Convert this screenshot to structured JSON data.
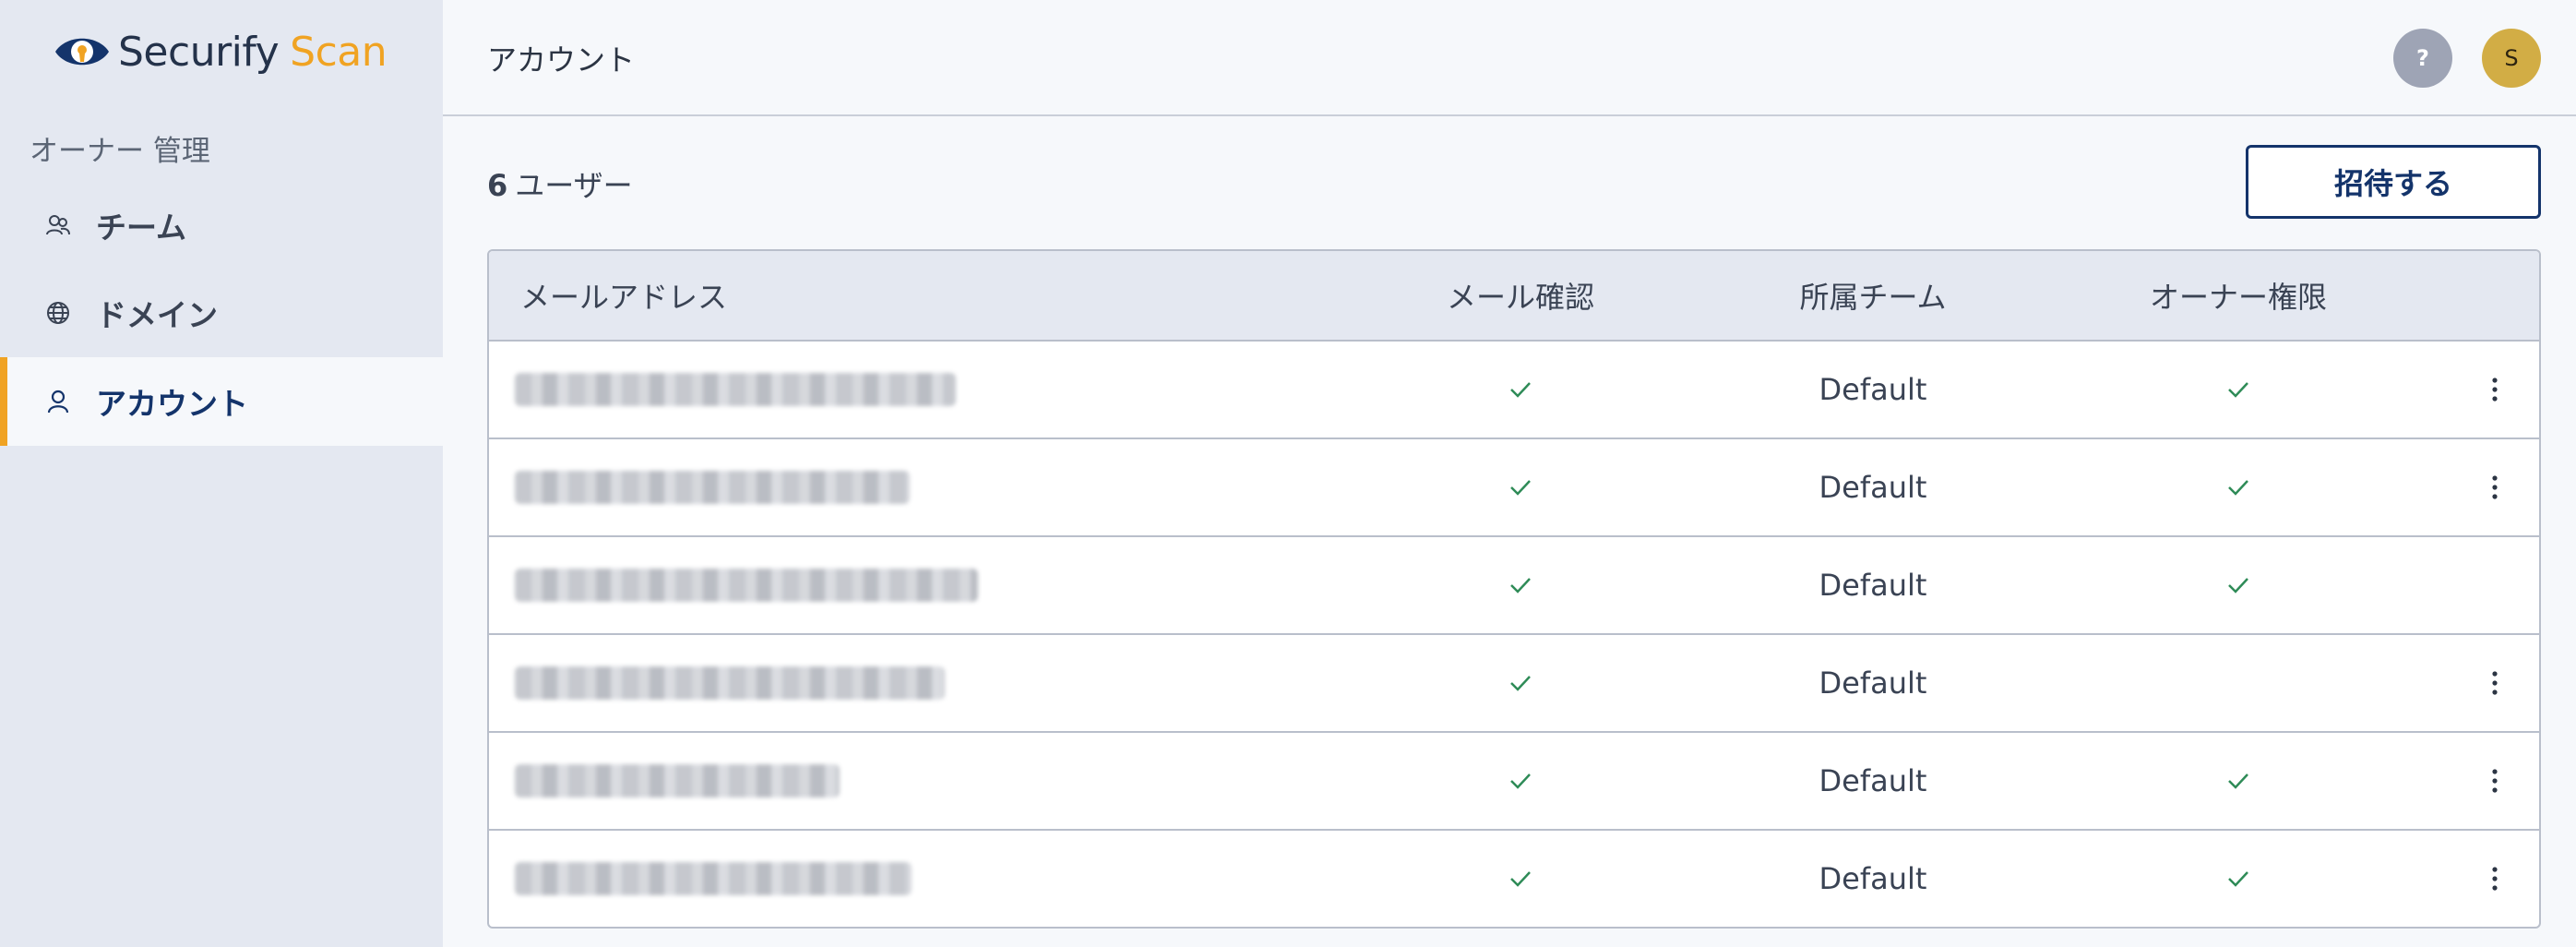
{
  "brand": {
    "name_part1": "Securify",
    "name_part2": "Scan",
    "accent": "#f0a323",
    "primary": "#14346b"
  },
  "sidebar": {
    "section_label": "オーナー 管理",
    "items": [
      {
        "label": "チーム",
        "icon": "team-icon",
        "active": false
      },
      {
        "label": "ドメイン",
        "icon": "globe-icon",
        "active": false
      },
      {
        "label": "アカウント",
        "icon": "user-icon",
        "active": true
      }
    ]
  },
  "header": {
    "title": "アカウント",
    "help_label": "?",
    "avatar_initial": "S"
  },
  "main": {
    "user_count": "6",
    "user_count_suffix": "ユーザー",
    "invite_label": "招待する"
  },
  "table": {
    "columns": [
      "メールアドレス",
      "メール確認",
      "所属チーム",
      "オーナー権限"
    ],
    "rows": [
      {
        "email": "",
        "verified": true,
        "team": "Default",
        "owner": true,
        "menu": true
      },
      {
        "email": "",
        "verified": true,
        "team": "Default",
        "owner": true,
        "menu": true
      },
      {
        "email": "",
        "verified": true,
        "team": "Default",
        "owner": true,
        "menu": false
      },
      {
        "email": "",
        "verified": true,
        "team": "Default",
        "owner": false,
        "menu": true
      },
      {
        "email": "",
        "verified": true,
        "team": "Default",
        "owner": true,
        "menu": true
      },
      {
        "email": "",
        "verified": true,
        "team": "Default",
        "owner": true,
        "menu": true
      }
    ],
    "check_color": "#2e8b57"
  }
}
